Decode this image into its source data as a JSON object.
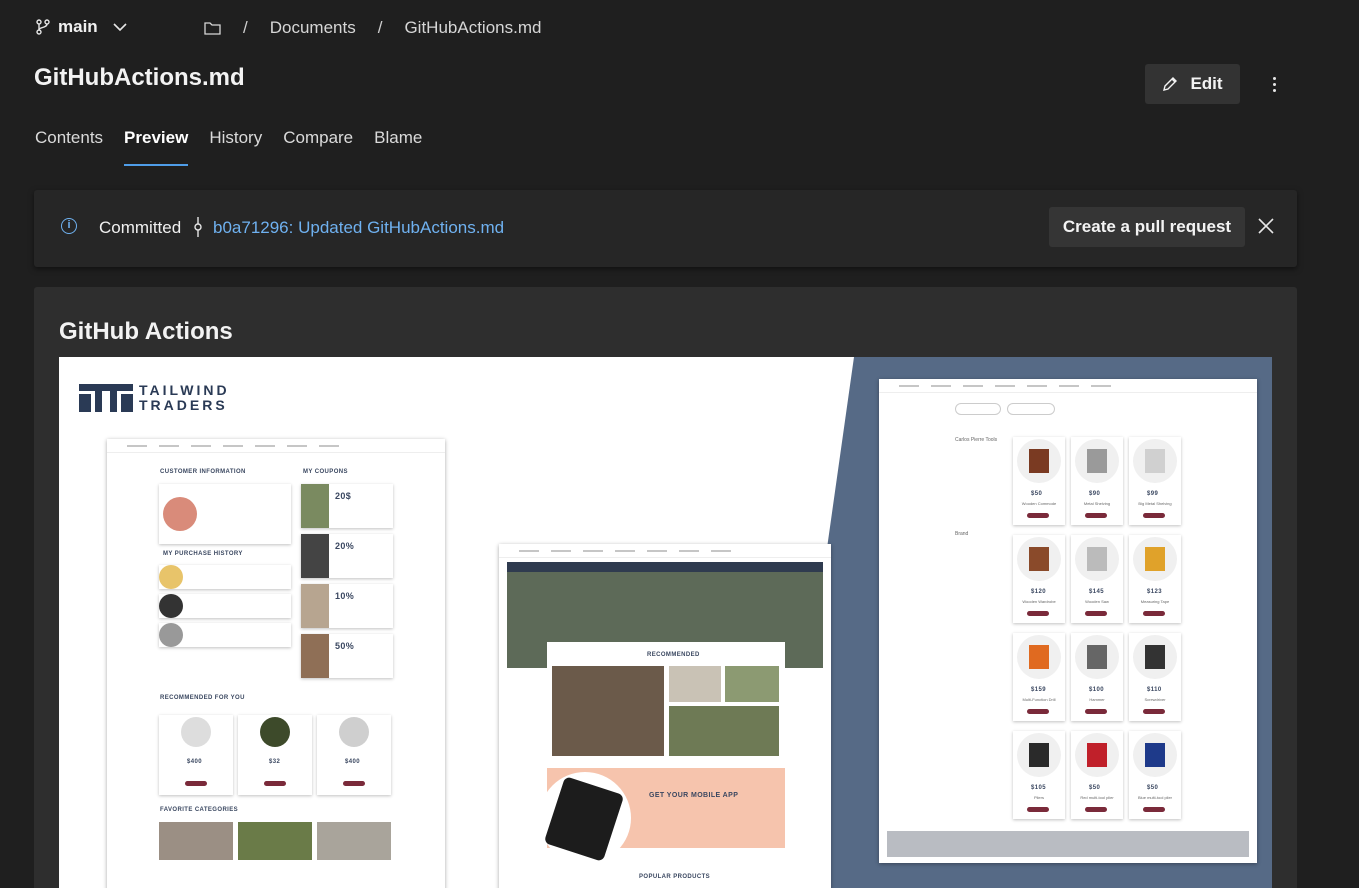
{
  "topbar": {
    "branch": "main",
    "breadcrumb": [
      "Documents",
      "GitHubActions.md"
    ],
    "separator": "/"
  },
  "file": {
    "title": "GitHubActions.md",
    "edit_label": "Edit"
  },
  "tabs": [
    {
      "label": "Contents",
      "active": false
    },
    {
      "label": "Preview",
      "active": true
    },
    {
      "label": "History",
      "active": false
    },
    {
      "label": "Compare",
      "active": false
    },
    {
      "label": "Blame",
      "active": false
    }
  ],
  "banner": {
    "committed_label": "Committed",
    "commit_link": "b0a71296: Updated GitHubActions.md",
    "pr_button": "Create a pull request"
  },
  "content": {
    "heading": "GitHub Actions",
    "image": {
      "logo_line1": "TAILWIND",
      "logo_line2": "TRADERS",
      "left_shot": {
        "customer_info": "CUSTOMER INFORMATION",
        "coupons": "MY COUPONS",
        "purchase_history": "MY PURCHASE HISTORY",
        "coupon_values": [
          "20$",
          "20%",
          "10%",
          "50%"
        ],
        "recommended": "RECOMMENDED FOR YOU",
        "rec_prices": [
          "$400",
          "$32",
          "$400"
        ],
        "favorite": "FAVORITE CATEGORIES"
      },
      "middle_shot": {
        "recommended": "RECOMMENDED",
        "app_promo": "GET YOUR MOBILE APP",
        "popular": "POPULAR PRODUCTS"
      },
      "right_shot": {
        "prices": [
          "$50",
          "$90",
          "$99",
          "$120",
          "$145",
          "$123",
          "$159",
          "$100",
          "$110",
          "$105",
          "$50",
          "$50"
        ],
        "names": [
          "Wooden Commode",
          "Metal Shelving",
          "Big Metal Shelving",
          "Wooden Wardrobe",
          "Wooden Saw",
          "Measuring Tape",
          "Multi-Function Drill",
          "Hammer",
          "Screwdriver",
          "Pliers",
          "Red multi-tool plier",
          "Blue multi-tool plier"
        ]
      }
    }
  },
  "colors": {
    "accent": "#4f9de8",
    "link": "#6fb1f0",
    "slate": "#566a86",
    "brand_navy": "#2a3a55"
  }
}
